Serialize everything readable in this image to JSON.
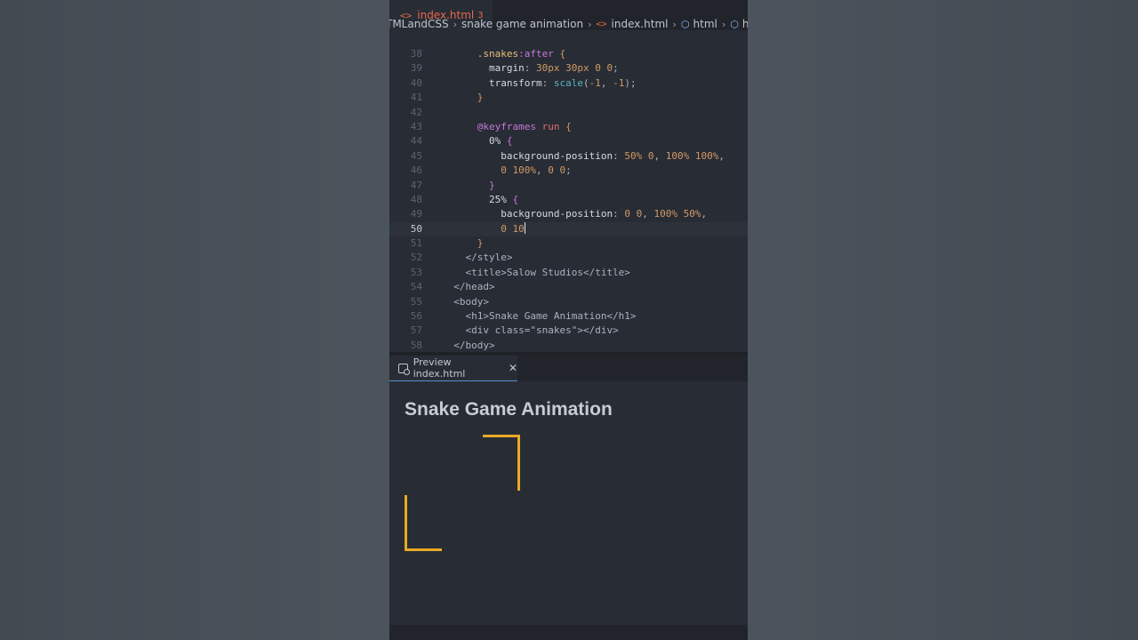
{
  "tab": {
    "icon": "<>",
    "filename": "index.html",
    "problems": "3"
  },
  "breadcrumb": [
    "TMLandCSS",
    "snake game animation",
    "index.html",
    "html",
    "head"
  ],
  "code_lines": [
    {
      "n": "38",
      "html": "      <span class='c-sel'>.snakes</span><span class='c-pseudo'>:after</span> <span class='c-brace'>{</span>"
    },
    {
      "n": "39",
      "html": "        <span class='c-prop'>margin</span>: <span class='c-num'>30px</span> <span class='c-num'>30px</span> <span class='c-num'>0</span> <span class='c-num'>0</span>;"
    },
    {
      "n": "40",
      "html": "        <span class='c-prop'>transform</span>: <span class='c-fn'>scale</span>(<span class='c-num'>-1</span>, <span class='c-num'>-1</span>);"
    },
    {
      "n": "41",
      "html": "      <span class='c-brace'>}</span>"
    },
    {
      "n": "42",
      "html": ""
    },
    {
      "n": "43",
      "html": "      <span class='c-at'>@keyframes</span> <span class='c-kw'>run</span> <span class='c-brace'>{</span>"
    },
    {
      "n": "44",
      "html": "        <span class='c-prop'>0%</span> <span class='c-brace2'>{</span>"
    },
    {
      "n": "45",
      "html": "          <span class='c-prop'>background-position</span>: <span class='c-num'>50%</span> <span class='c-num'>0</span>, <span class='c-num'>100%</span> <span class='c-num'>100%</span>,"
    },
    {
      "n": "46",
      "html": "          <span class='c-num'>0</span> <span class='c-num'>100%</span>, <span class='c-num'>0</span> <span class='c-num'>0</span>;"
    },
    {
      "n": "47",
      "html": "        <span class='c-brace2'>}</span>"
    },
    {
      "n": "48",
      "html": "        <span class='c-prop'>25%</span> <span class='c-brace2'>{</span>"
    },
    {
      "n": "49",
      "html": "          <span class='c-prop'>background-position</span>: <span class='c-num'>0</span> <span class='c-num'>0</span>, <span class='c-num'>100%</span> <span class='c-num'>50%</span>,"
    },
    {
      "n": "50",
      "html": "          <span class='c-num'>0</span> <span class='c-num'>10</span><span class='cursor'></span>",
      "active": true
    },
    {
      "n": "51",
      "html": "      <span class='c-brace'>}</span>"
    },
    {
      "n": "52",
      "html": "    <span class='c-tag'>&lt;/style&gt;</span>"
    },
    {
      "n": "53",
      "html": "    <span class='c-tag'>&lt;title&gt;Salow Studios&lt;/title&gt;</span>"
    },
    {
      "n": "54",
      "html": "  <span class='c-tag'>&lt;/head&gt;</span>"
    },
    {
      "n": "55",
      "html": "  <span class='c-tag'>&lt;body&gt;</span>"
    },
    {
      "n": "56",
      "html": "    <span class='c-tag'>&lt;h1&gt;Snake Game Animation&lt;/h1&gt;</span>"
    },
    {
      "n": "57",
      "html": "    <span class='c-tag'>&lt;div class=\"snakes\"&gt;&lt;/div&gt;</span>"
    },
    {
      "n": "58",
      "html": "  <span class='c-tag'>&lt;/body&gt;</span>"
    }
  ],
  "preview_tab": {
    "label": "Preview index.html",
    "close": "✕"
  },
  "preview": {
    "heading": "Snake Game Animation"
  },
  "colors": {
    "accent": "#e9a826",
    "editor_bg": "#282c34"
  }
}
